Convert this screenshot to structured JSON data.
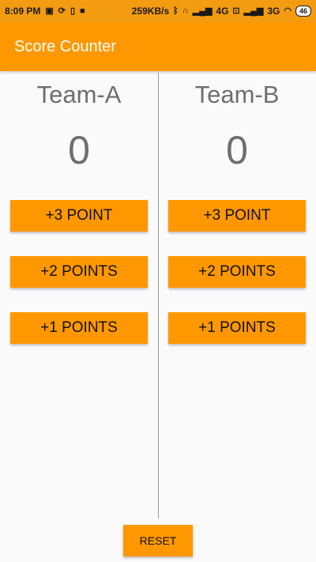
{
  "status_bar": {
    "time": "8:09 PM",
    "speed": "259KB/s",
    "network_1": "4G",
    "network_2": "3G",
    "battery": "46",
    "icons": [
      "image-icon",
      "sync-icon",
      "vibrate-icon",
      "video-icon",
      "bluetooth-icon",
      "headset-icon",
      "signal-icon",
      "volte-icon",
      "signal-icon",
      "wifi-icon",
      "battery-icon"
    ]
  },
  "app_bar": {
    "title": "Score Counter"
  },
  "team_a": {
    "name": "Team-A",
    "score": "0",
    "buttons": [
      "+3 POINT",
      "+2 POINTS",
      "+1 POINTS"
    ]
  },
  "team_b": {
    "name": "Team-B",
    "score": "0",
    "buttons": [
      "+3 POINT",
      "+2 POINTS",
      "+1 POINTS"
    ]
  },
  "reset_label": "RESET",
  "colors": {
    "status_bar": "#f39c12",
    "primary": "#ff9800",
    "background": "#fafafa",
    "text_secondary": "#6e6e6e"
  }
}
